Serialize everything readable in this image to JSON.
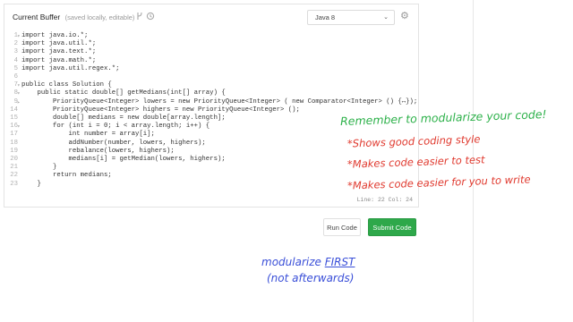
{
  "editor": {
    "title": "Current Buffer",
    "subtitle": "(saved locally, editable)",
    "language": "Java 8",
    "status": "Line: 22 Col: 24",
    "lines": [
      {
        "n": "1",
        "fold": "▾",
        "text": "import java.io.*;"
      },
      {
        "n": "2",
        "fold": "",
        "text": "import java.util.*;"
      },
      {
        "n": "3",
        "fold": "",
        "text": "import java.text.*;"
      },
      {
        "n": "4",
        "fold": "",
        "text": "import java.math.*;"
      },
      {
        "n": "5",
        "fold": "",
        "text": "import java.util.regex.*;"
      },
      {
        "n": "6",
        "fold": "",
        "text": ""
      },
      {
        "n": "7",
        "fold": "▾",
        "text": "public class Solution {"
      },
      {
        "n": "8",
        "fold": "▾",
        "text": "    public static double[] getMedians(int[] array) {"
      },
      {
        "n": "9",
        "fold": "▸",
        "text": "        PriorityQueue<Integer> lowers = new PriorityQueue<Integer> ( new Comparator<Integer> () {↔});"
      },
      {
        "n": "14",
        "fold": "",
        "text": "        PriorityQueue<Integer> highers = new PriorityQueue<Integer> ();"
      },
      {
        "n": "15",
        "fold": "",
        "text": "        double[] medians = new double[array.length];"
      },
      {
        "n": "16",
        "fold": "▾",
        "text": "        for (int i = 0; i < array.length; i++) {"
      },
      {
        "n": "17",
        "fold": "",
        "text": "            int number = array[i];"
      },
      {
        "n": "18",
        "fold": "",
        "text": "            addNumber(number, lowers, highers);"
      },
      {
        "n": "19",
        "fold": "",
        "text": "            rebalance(lowers, highers);"
      },
      {
        "n": "20",
        "fold": "",
        "text": "            medians[i] = getMedian(lowers, highers);"
      },
      {
        "n": "21",
        "fold": "",
        "text": "        }"
      },
      {
        "n": "22",
        "fold": "",
        "text": "        return medians;"
      },
      {
        "n": "23",
        "fold": "",
        "text": "    }"
      }
    ]
  },
  "buttons": {
    "run": "Run Code",
    "submit": "Submit Code"
  },
  "annotations": {
    "green": "Remember to modularize your code!",
    "red": [
      "*Shows good coding style",
      "*Makes code easier to test",
      "*Makes code easier for you to write"
    ],
    "blue1_a": "modularize ",
    "blue1_b": "FIRST",
    "blue2": "(not afterwards)"
  },
  "colors": {
    "submit": "#2ea84a",
    "annotation_green": "#2db14a",
    "annotation_red": "#e03a2f",
    "annotation_blue": "#3a4fd8"
  }
}
